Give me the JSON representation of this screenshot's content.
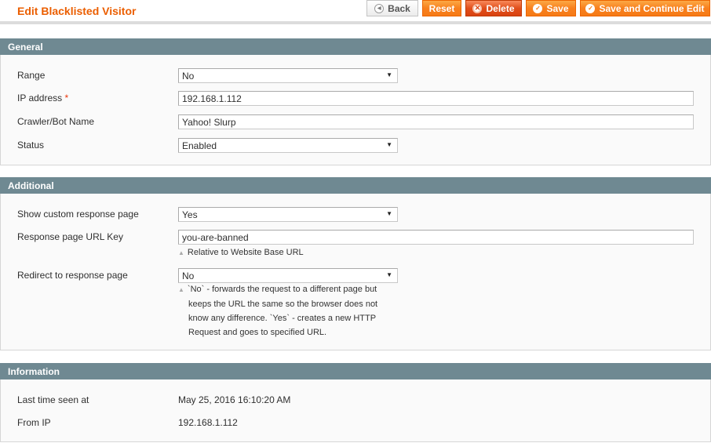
{
  "header": {
    "title": "Edit Blacklisted Visitor",
    "buttons": {
      "back": "Back",
      "reset": "Reset",
      "delete": "Delete",
      "save": "Save",
      "save_continue": "Save and Continue Edit"
    }
  },
  "general": {
    "title": "General",
    "range": {
      "label": "Range",
      "value": "No"
    },
    "ip_address": {
      "label": "IP address",
      "required_mark": "*",
      "value": "192.168.1.112"
    },
    "crawler": {
      "label": "Crawler/Bot Name",
      "value": "Yahoo! Slurp"
    },
    "status": {
      "label": "Status",
      "value": "Enabled"
    }
  },
  "additional": {
    "title": "Additional",
    "show_custom": {
      "label": "Show custom response page",
      "value": "Yes"
    },
    "url_key": {
      "label": "Response page URL Key",
      "value": "you-are-banned",
      "note": "Relative to Website Base URL"
    },
    "redirect": {
      "label": "Redirect to response page",
      "value": "No",
      "note_lines": [
        "`No` - forwards the request to a different page but",
        "keeps the URL the same so the browser does not",
        "know any difference. `Yes` - creates a new HTTP",
        "Request and goes to specified URL."
      ]
    }
  },
  "information": {
    "title": "Information",
    "last_seen": {
      "label": "Last time seen at",
      "value": "May 25, 2016 16:10:20 AM"
    },
    "from_ip": {
      "label": "From IP",
      "value": "192.168.1.112"
    }
  },
  "icons": {
    "caret": "▼",
    "note_arrow": "▲",
    "back": "◀",
    "delete": "✕",
    "check": "✓"
  }
}
